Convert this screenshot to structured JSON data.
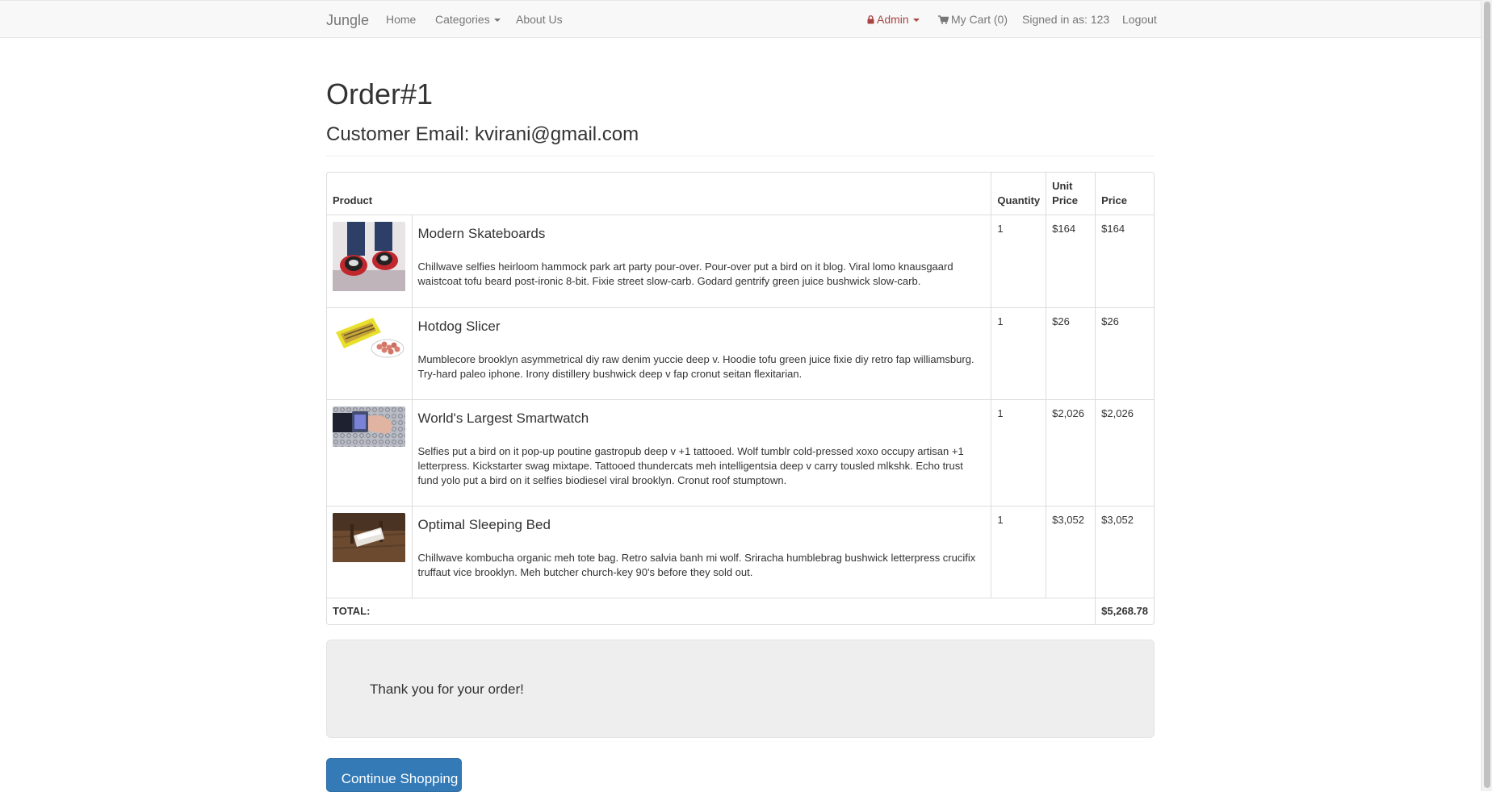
{
  "nav": {
    "brand": "Jungle",
    "home": "Home",
    "categories": "Categories",
    "about": "About Us",
    "admin": "Admin",
    "cart": "My Cart (0)",
    "signed_in": "Signed in as: 123",
    "logout": "Logout",
    "icons": {
      "lock": "lock-icon",
      "cart": "shopping-cart-icon"
    },
    "colors": {
      "admin": "#a94442"
    }
  },
  "order": {
    "title": "Order#1",
    "email_line": "Customer Email: kvirani@gmail.com"
  },
  "table": {
    "headers": {
      "product": "Product",
      "quantity": "Quantity",
      "unit_price_1": "Unit",
      "unit_price_2": "Price",
      "price": "Price"
    },
    "items": [
      {
        "name": "Modern Skateboards",
        "description": "Chillwave selfies heirloom hammock park art party pour-over. Pour-over put a bird on it blog. Viral lomo knausgaard waistcoat tofu beard post-ironic 8-bit. Fixie street slow-carb. Godard gentrify green juice bushwick slow-carb.",
        "quantity": "1",
        "unit_price": "$164",
        "price": "$164"
      },
      {
        "name": "Hotdog Slicer",
        "description": "Mumblecore brooklyn asymmetrical diy raw denim yuccie deep v. Hoodie tofu green juice fixie diy retro fap williamsburg. Try-hard paleo iphone. Irony distillery bushwick deep v fap cronut seitan flexitarian.",
        "quantity": "1",
        "unit_price": "$26",
        "price": "$26"
      },
      {
        "name": "World's Largest Smartwatch",
        "description": "Selfies put a bird on it pop-up poutine gastropub deep v +1 tattooed. Wolf tumblr cold-pressed xoxo occupy artisan +1 letterpress. Kickstarter swag mixtape. Tattooed thundercats meh intelligentsia deep v carry tousled mlkshk. Echo trust fund yolo put a bird on it selfies biodiesel viral brooklyn. Cronut roof stumptown.",
        "quantity": "1",
        "unit_price": "$2,026",
        "price": "$2,026"
      },
      {
        "name": "Optimal Sleeping Bed",
        "description": "Chillwave kombucha organic meh tote bag. Retro salvia banh mi wolf. Sriracha humblebrag bushwick letterpress crucifix truffaut vice brooklyn. Meh butcher church-key 90's before they sold out.",
        "quantity": "1",
        "unit_price": "$3,052",
        "price": "$3,052"
      }
    ],
    "total_label": "TOTAL:",
    "total_value": "$5,268.78"
  },
  "thanks": "Thank you for your order!",
  "continue_button": "Continue Shopping",
  "colors": {
    "primary_button": "#337ab7",
    "navbar_bg": "#f8f8f8"
  }
}
